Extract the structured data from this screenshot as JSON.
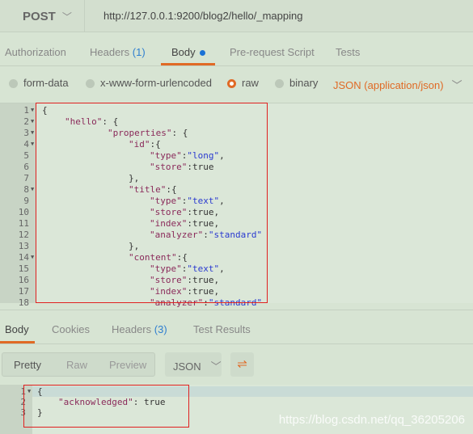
{
  "request": {
    "method": "POST",
    "url": "http://127.0.0.1:9200/blog2/hello/_mapping"
  },
  "req_tabs": [
    {
      "label": "Authorization"
    },
    {
      "label": "Headers",
      "count": "(1)"
    },
    {
      "label": "Body",
      "active": true
    },
    {
      "label": "Pre-request Script"
    },
    {
      "label": "Tests"
    }
  ],
  "body_options": [
    {
      "label": "form-data",
      "selected": false
    },
    {
      "label": "x-www-form-urlencoded",
      "selected": false
    },
    {
      "label": "raw",
      "selected": true
    },
    {
      "label": "binary",
      "selected": false
    }
  ],
  "content_type": "JSON (application/json)",
  "request_body": [
    {
      "n": "1",
      "fold": true,
      "i": 0,
      "seg": [
        [
          "p",
          "{"
        ]
      ]
    },
    {
      "n": "2",
      "fold": true,
      "i": 1,
      "seg": [
        [
          "k",
          "\"hello\""
        ],
        [
          "p",
          ": {"
        ]
      ]
    },
    {
      "n": "3",
      "fold": true,
      "i": 2,
      "seg": [
        [
          "k",
          "\"properties\""
        ],
        [
          "p",
          ": {"
        ]
      ]
    },
    {
      "n": "4",
      "fold": true,
      "i": 3,
      "seg": [
        [
          "k",
          "\"id\""
        ],
        [
          "p",
          ":{"
        ]
      ]
    },
    {
      "n": "5",
      "i": 4,
      "seg": [
        [
          "k",
          "\"type\""
        ],
        [
          "p",
          ":"
        ],
        [
          "s",
          "\"long\""
        ],
        [
          "p",
          ","
        ]
      ]
    },
    {
      "n": "6",
      "i": 4,
      "seg": [
        [
          "k",
          "\"store\""
        ],
        [
          "p",
          ":true"
        ]
      ]
    },
    {
      "n": "7",
      "i": 3,
      "seg": [
        [
          "p",
          "},"
        ]
      ]
    },
    {
      "n": "8",
      "fold": true,
      "i": 3,
      "seg": [
        [
          "k",
          "\"title\""
        ],
        [
          "p",
          ":{"
        ]
      ]
    },
    {
      "n": "9",
      "i": 4,
      "seg": [
        [
          "k",
          "\"type\""
        ],
        [
          "p",
          ":"
        ],
        [
          "s",
          "\"text\""
        ],
        [
          "p",
          ","
        ]
      ]
    },
    {
      "n": "10",
      "i": 4,
      "seg": [
        [
          "k",
          "\"store\""
        ],
        [
          "p",
          ":true,"
        ]
      ]
    },
    {
      "n": "11",
      "i": 4,
      "seg": [
        [
          "k",
          "\"index\""
        ],
        [
          "p",
          ":true,"
        ]
      ]
    },
    {
      "n": "12",
      "i": 4,
      "seg": [
        [
          "k",
          "\"analyzer\""
        ],
        [
          "p",
          ":"
        ],
        [
          "s",
          "\"standard\""
        ]
      ]
    },
    {
      "n": "13",
      "i": 3,
      "seg": [
        [
          "p",
          "},"
        ]
      ]
    },
    {
      "n": "14",
      "fold": true,
      "i": 3,
      "seg": [
        [
          "k",
          "\"content\""
        ],
        [
          "p",
          ":{"
        ]
      ]
    },
    {
      "n": "15",
      "i": 4,
      "seg": [
        [
          "k",
          "\"type\""
        ],
        [
          "p",
          ":"
        ],
        [
          "s",
          "\"text\""
        ],
        [
          "p",
          ","
        ]
      ]
    },
    {
      "n": "16",
      "i": 4,
      "seg": [
        [
          "k",
          "\"store\""
        ],
        [
          "p",
          ":true,"
        ]
      ]
    },
    {
      "n": "17",
      "i": 4,
      "seg": [
        [
          "k",
          "\"index\""
        ],
        [
          "p",
          ":true,"
        ]
      ]
    },
    {
      "n": "18",
      "i": 4,
      "seg": [
        [
          "k",
          "\"analyzer\""
        ],
        [
          "p",
          ":"
        ],
        [
          "s",
          "\"standard\""
        ]
      ]
    }
  ],
  "resp_tabs": [
    {
      "label": "Body",
      "active": true
    },
    {
      "label": "Cookies"
    },
    {
      "label": "Headers",
      "count": "(3)"
    },
    {
      "label": "Test Results"
    }
  ],
  "resp_view": {
    "modes": [
      "Pretty",
      "Raw",
      "Preview"
    ],
    "format": "JSON",
    "wrap_icon": "wrap-lines-icon"
  },
  "response_body": [
    {
      "n": "1",
      "fold": true,
      "i": 0,
      "seg": [
        [
          "p",
          "{"
        ]
      ]
    },
    {
      "n": "2",
      "i": 1,
      "seg": [
        [
          "k",
          "\"acknowledged\""
        ],
        [
          "p",
          ": true"
        ]
      ]
    },
    {
      "n": "3",
      "i": 0,
      "seg": [
        [
          "p",
          "}"
        ]
      ]
    }
  ],
  "watermark": "https://blog.csdn.net/qq_36205206",
  "colors": {
    "accent": "#e06a25",
    "background": "#d7e4d3",
    "highlight": "#e02020"
  }
}
